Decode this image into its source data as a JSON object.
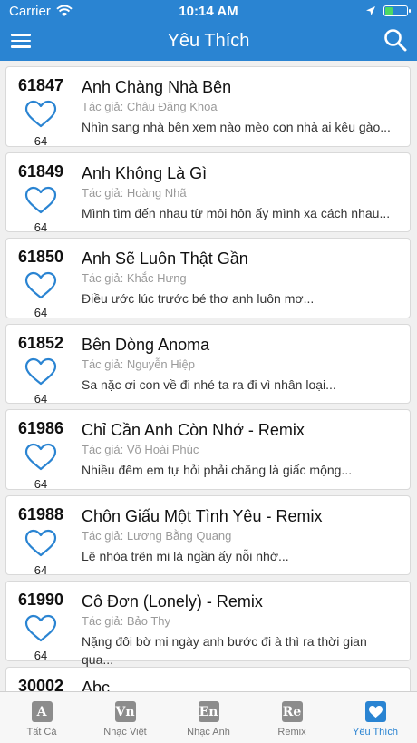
{
  "status_bar": {
    "carrier": "Carrier",
    "time": "10:14 AM"
  },
  "nav": {
    "title": "Yêu Thích"
  },
  "songs": [
    {
      "code": "61847",
      "title": "Anh Chàng Nhà Bên",
      "author": "Tác giả: Châu Đăng Khoa",
      "excerpt": "Nhìn sang nhà bên xem nào mèo con nhà ai kêu gào...",
      "likes": "64"
    },
    {
      "code": "61849",
      "title": "Anh Không Là Gì",
      "author": "Tác giả: Hoàng Nhã",
      "excerpt": "Mình tìm đến nhau từ môi hôn ấy mình xa cách nhau...",
      "likes": "64"
    },
    {
      "code": "61850",
      "title": "Anh Sẽ Luôn Thật Gần",
      "author": "Tác giả: Khắc Hưng",
      "excerpt": "Điều ước lúc trước bé thơ anh luôn mơ...",
      "likes": "64"
    },
    {
      "code": "61852",
      "title": "Bên Dòng Anoma",
      "author": "Tác giả: Nguyễn Hiệp",
      "excerpt": "Sa nặc ơi con về đi nhé ta ra đi vì nhân loại...",
      "likes": "64"
    },
    {
      "code": "61986",
      "title": "Chỉ Cần Anh Còn Nhớ - Remix",
      "author": "Tác giả: Võ Hoài Phúc",
      "excerpt": "Nhiều đêm em tự hỏi phải chăng là giấc mộng...",
      "likes": "64"
    },
    {
      "code": "61988",
      "title": "Chôn Giấu Một Tình Yêu - Remix",
      "author": "Tác giả: Lương Bằng Quang",
      "excerpt": "Lệ nhòa trên mi là ngần ấy nỗi nhớ...",
      "likes": "64"
    },
    {
      "code": "61990",
      "title": "Cô Đơn (Lonely) - Remix",
      "author": "Tác giả: Bảo Thy",
      "excerpt": "Nặng đôi bờ mi ngày anh bước đi à thì ra thời gian qua...",
      "likes": "64"
    },
    {
      "code": "30002",
      "title": "Abc",
      "author": "",
      "excerpt": "",
      "likes": ""
    }
  ],
  "tabs": [
    {
      "label": "Tất Cả",
      "icon_text": "A",
      "icon": "all-songs-icon"
    },
    {
      "label": "Nhạc Việt",
      "icon_text": "Vn",
      "icon": "vietnamese-music-icon"
    },
    {
      "label": "Nhạc Anh",
      "icon_text": "En",
      "icon": "english-music-icon"
    },
    {
      "label": "Remix",
      "icon_text": "Re",
      "icon": "remix-icon"
    },
    {
      "label": "Yêu Thích",
      "icon_text": "",
      "icon": "favorites-heart-icon"
    }
  ],
  "colors": {
    "header": "#2a84d2",
    "heart": "#2a84d2",
    "active_tab": "#2a84d2"
  }
}
